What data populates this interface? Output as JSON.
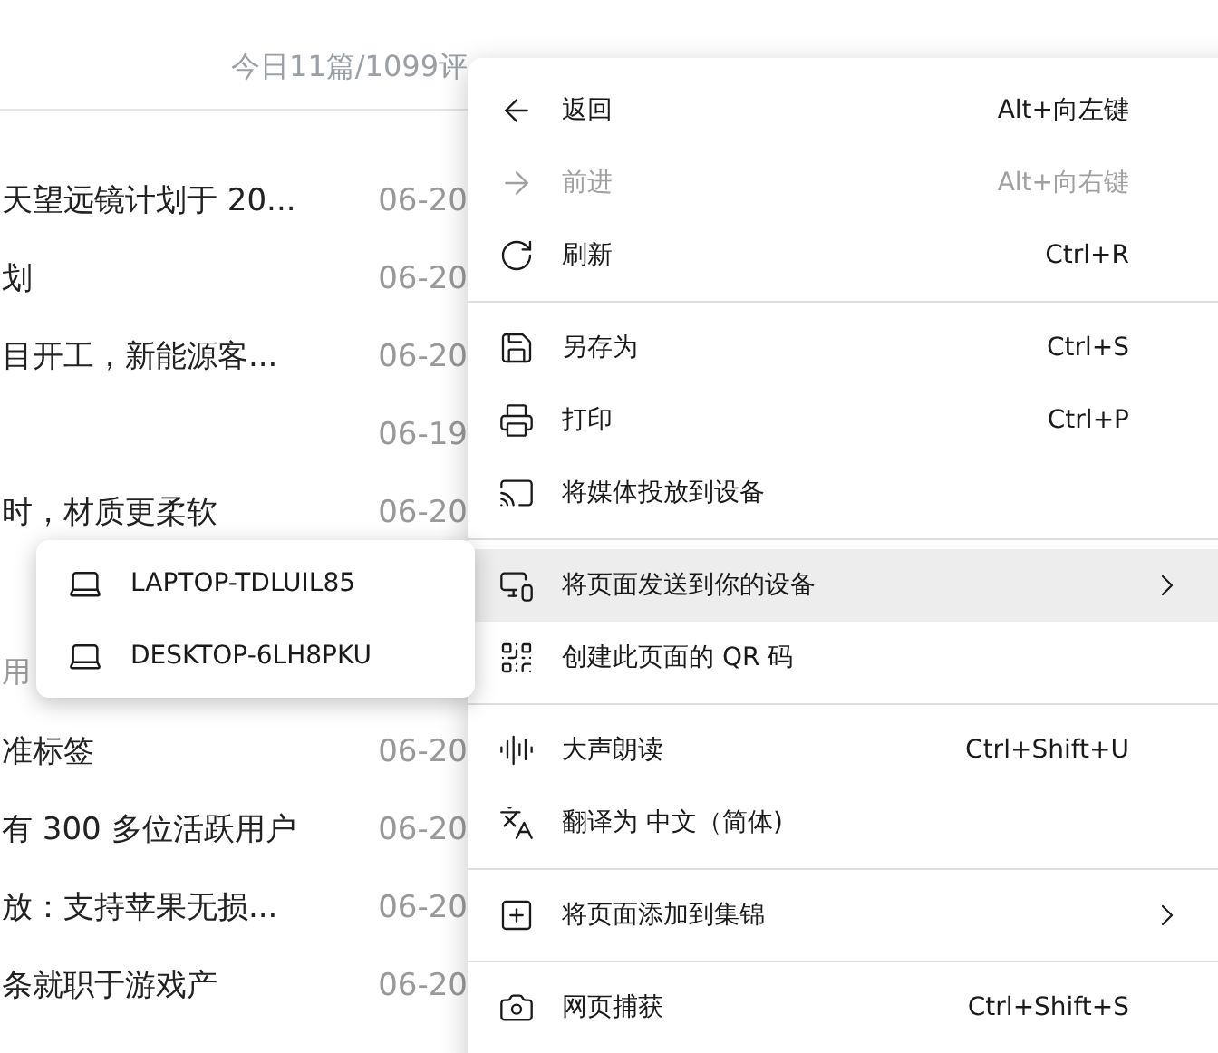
{
  "page": {
    "header": "今日11篇/1099评",
    "rows": [
      {
        "kind": "article",
        "title": "天望远镜计划于 20...",
        "date": "06-20"
      },
      {
        "kind": "article",
        "title": "划",
        "date": "06-20"
      },
      {
        "kind": "article",
        "title": "目开工，新能源客...",
        "date": "06-20"
      },
      {
        "kind": "article",
        "date": "06-19"
      },
      {
        "kind": "article",
        "title": "时，材质更柔软",
        "date": "06-20"
      },
      {
        "kind": "note",
        "title": "用"
      },
      {
        "kind": "article",
        "title": "准标签",
        "date": "06-20"
      },
      {
        "kind": "article",
        "title": "有 300 多位活跃用户",
        "date": "06-20"
      },
      {
        "kind": "article",
        "title": "放：支持苹果无损...",
        "date": "06-20"
      },
      {
        "kind": "article",
        "title": "条就职于游戏产",
        "date": "06-20"
      }
    ]
  },
  "menu": {
    "groups": [
      [
        {
          "label": "返回",
          "shortcut": "Alt+向左键",
          "disabled": false,
          "highlighted": false,
          "submenu": false
        },
        {
          "label": "前进",
          "shortcut": "Alt+向右键",
          "disabled": true,
          "highlighted": false,
          "submenu": false
        },
        {
          "label": "刷新",
          "shortcut": "Ctrl+R",
          "disabled": false,
          "highlighted": false,
          "submenu": false
        }
      ],
      [
        {
          "label": "另存为",
          "shortcut": "Ctrl+S",
          "disabled": false,
          "highlighted": false,
          "submenu": false
        },
        {
          "label": "打印",
          "shortcut": "Ctrl+P",
          "disabled": false,
          "highlighted": false,
          "submenu": false
        },
        {
          "label": "将媒体投放到设备",
          "disabled": false,
          "highlighted": false,
          "submenu": false
        }
      ],
      [
        {
          "label": "将页面发送到你的设备",
          "disabled": false,
          "highlighted": true,
          "submenu": true
        },
        {
          "label": "创建此页面的 QR 码",
          "disabled": false,
          "highlighted": false,
          "submenu": false
        }
      ],
      [
        {
          "label": "大声朗读",
          "shortcut": "Ctrl+Shift+U",
          "disabled": false,
          "highlighted": false,
          "submenu": false
        },
        {
          "label": "翻译为 中文（简体)",
          "disabled": false,
          "highlighted": false,
          "submenu": false
        }
      ],
      [
        {
          "label": "将页面添加到集锦",
          "disabled": false,
          "highlighted": false,
          "submenu": true
        }
      ],
      [
        {
          "label": "网页捕获",
          "shortcut": "Ctrl+Shift+S",
          "disabled": false,
          "highlighted": false,
          "submenu": false
        }
      ]
    ]
  },
  "submenu": {
    "items": [
      {
        "label": "LAPTOP-TDLUIL85"
      },
      {
        "label": "DESKTOP-6LH8PKU"
      }
    ]
  }
}
